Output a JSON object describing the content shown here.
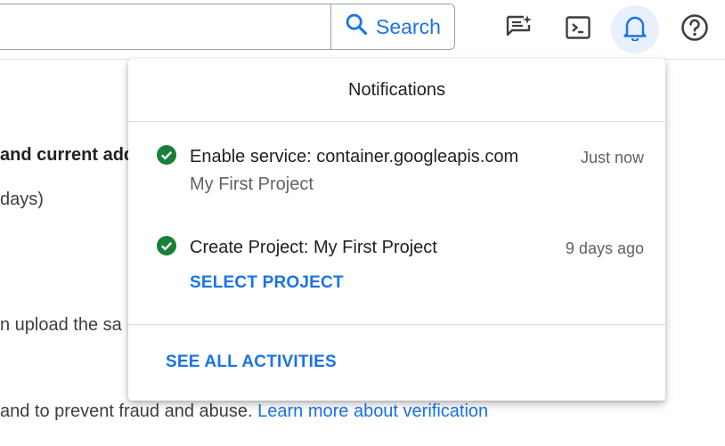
{
  "header": {
    "search_label": "Search",
    "icons": [
      "search-icon",
      "feedback-icon",
      "cloud-shell-icon",
      "notifications-bell-icon",
      "help-icon"
    ],
    "accent_color": "#1a73e8"
  },
  "background": {
    "line1": "and current add",
    "line2": "days)",
    "line3": "n upload the sa",
    "line4_text": " and to prevent fraud and abuse. ",
    "line4_link": "Learn more about verification"
  },
  "notifications": {
    "title": "Notifications",
    "items": [
      {
        "title": "Enable service: container.googleapis.com",
        "subtitle": "My First Project",
        "time": "Just now",
        "status": "success"
      },
      {
        "title": "Create Project: My First Project",
        "action": "SELECT PROJECT",
        "time": "9 days ago",
        "status": "success"
      }
    ],
    "see_all": "SEE ALL ACTIVITIES",
    "success_color": "#188038"
  }
}
